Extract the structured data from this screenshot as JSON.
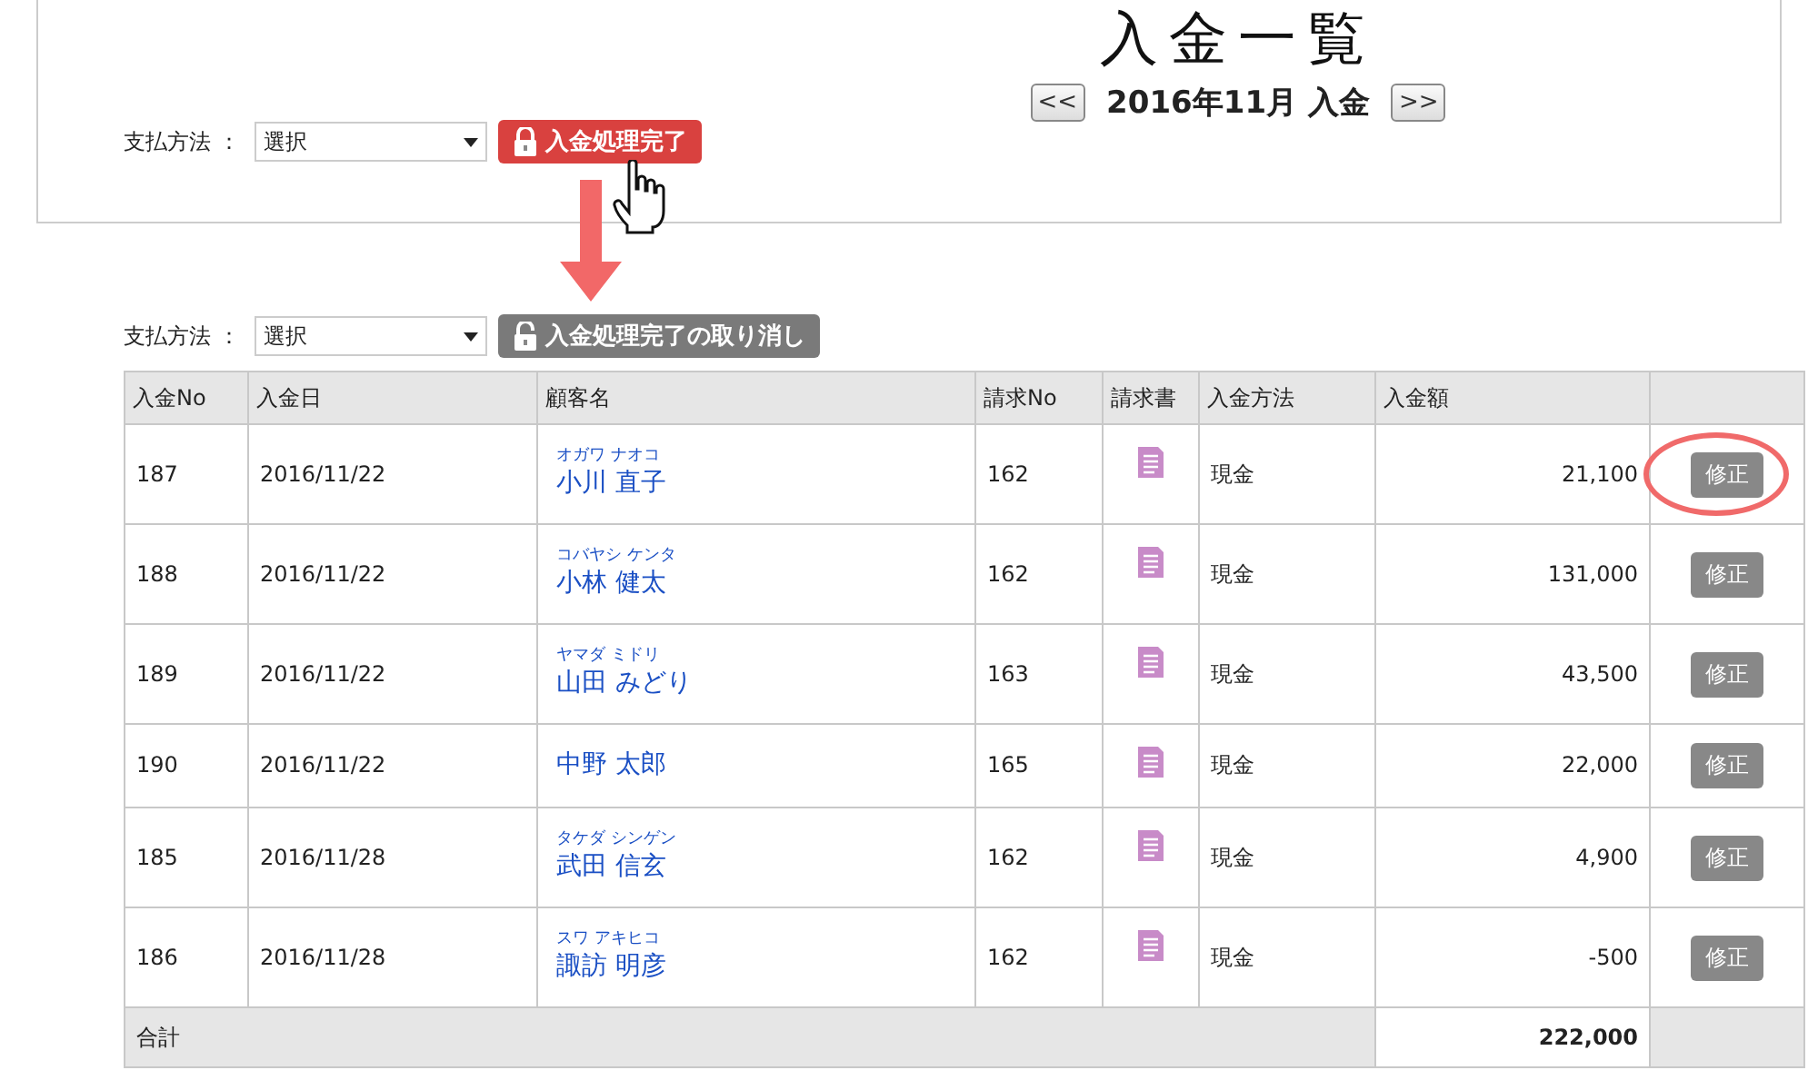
{
  "title": "入金一覧",
  "period": {
    "prev": "<<",
    "label": "2016年11月 入金",
    "next": ">>"
  },
  "filters": [
    {
      "label": "支払方法 ：",
      "value": "選択",
      "button": {
        "label": "入金処理完了",
        "kind": "complete"
      }
    },
    {
      "label": "支払方法 ：",
      "value": "選択",
      "button": {
        "label": "入金処理完了の取り消し",
        "kind": "cancel"
      }
    }
  ],
  "table": {
    "columns": [
      "入金No",
      "入金日",
      "顧客名",
      "請求No",
      "請求書",
      "入金方法",
      "入金額"
    ],
    "rows": [
      {
        "no": "187",
        "date": "2016/11/22",
        "kana": "オガワ ナオコ",
        "name": "小川 直子",
        "invoice_no": "162",
        "method": "現金",
        "amount": "21,100",
        "action": "修正",
        "circled": true
      },
      {
        "no": "188",
        "date": "2016/11/22",
        "kana": "コバヤシ ケンタ",
        "name": "小林 健太",
        "invoice_no": "162",
        "method": "現金",
        "amount": "131,000",
        "action": "修正",
        "circled": false
      },
      {
        "no": "189",
        "date": "2016/11/22",
        "kana": "ヤマダ ミドリ",
        "name": "山田 みどり",
        "invoice_no": "163",
        "method": "現金",
        "amount": "43,500",
        "action": "修正",
        "circled": false
      },
      {
        "no": "190",
        "date": "2016/11/22",
        "name": "中野 太郎",
        "invoice_no": "165",
        "method": "現金",
        "amount": "22,000",
        "action": "修正",
        "circled": false
      },
      {
        "no": "185",
        "date": "2016/11/28",
        "kana": "タケダ シンゲン",
        "name": "武田 信玄",
        "invoice_no": "162",
        "method": "現金",
        "amount": "4,900",
        "action": "修正",
        "circled": false
      },
      {
        "no": "186",
        "date": "2016/11/28",
        "kana": "スワ アキヒコ",
        "name": "諏訪 明彦",
        "invoice_no": "162",
        "method": "現金",
        "amount": "-500",
        "action": "修正",
        "circled": false
      }
    ],
    "total": {
      "label": "合計",
      "amount": "222,000"
    }
  }
}
